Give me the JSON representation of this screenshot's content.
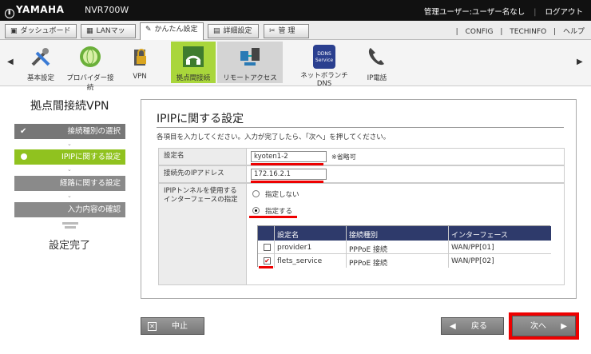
{
  "header": {
    "brand": "YAMAHA",
    "model": "NVR700W",
    "user": "管理ユーザー:ユーザー名なし",
    "logout": "ログアウト"
  },
  "tabs": [
    {
      "label": "ダッシュボード",
      "icon": "dashboard-icon"
    },
    {
      "label": "LANマップ",
      "icon": "lan-map-icon"
    },
    {
      "label": "かんたん設定",
      "icon": "easy-setup-icon",
      "active": true
    },
    {
      "label": "詳細設定",
      "icon": "detail-settings-icon"
    },
    {
      "label": "管 理",
      "icon": "wrench-icon"
    }
  ],
  "toplinks": [
    "CONFIG",
    "TECHINFO",
    "ヘルプ"
  ],
  "iconmenu": [
    {
      "label": "基本設定",
      "icon": "tools-icon"
    },
    {
      "label": "プロバイダー接続",
      "icon": "globe-icon"
    },
    {
      "label": "VPN",
      "icon": "vpn-lock-icon"
    },
    {
      "label": "拠点間接続",
      "icon": "site-connection-icon"
    },
    {
      "label": "リモートアクセス",
      "icon": "remote-access-icon"
    },
    {
      "label": "ネットボランチDNS",
      "icon": "ddns-service-icon"
    },
    {
      "label": "IP電話",
      "icon": "phone-icon"
    }
  ],
  "ddns_icon_text": "DDNS Service",
  "steps": {
    "title": "拠点間接続VPN",
    "items": [
      "接続種別の選択",
      "IPIPに関する設定",
      "経路に関する設定",
      "入力内容の確認"
    ],
    "done": "設定完了"
  },
  "panel": {
    "title": "IPIPに関する設定",
    "description": "各項目を入力してください。入力が完了したら、「次へ」を押してください。",
    "name_label": "設定名",
    "name_value": "kyoten1-2",
    "name_note": "※省略可",
    "ip_label": "接続先のIPアドレス",
    "ip_value": "172.16.2.1",
    "iface_label": "IPIPトンネルを使用するインターフェースの指定",
    "opt_none": "指定しない",
    "opt_specify": "指定する",
    "table": {
      "headers": [
        "設定名",
        "接続種別",
        "インターフェース"
      ],
      "rows": [
        {
          "name": "provider1",
          "type": "PPPoE 接続",
          "iface": "WAN/PP[01]",
          "checked": false
        },
        {
          "name": "flets_service",
          "type": "PPPoE 接続",
          "iface": "WAN/PP[02]",
          "checked": true
        }
      ]
    }
  },
  "buttons": {
    "cancel": "中止",
    "back": "戻る",
    "next": "次へ"
  },
  "colors": {
    "accent_green": "#90c21f",
    "table_header": "#2e3a6b",
    "highlight_red": "#e00000"
  }
}
